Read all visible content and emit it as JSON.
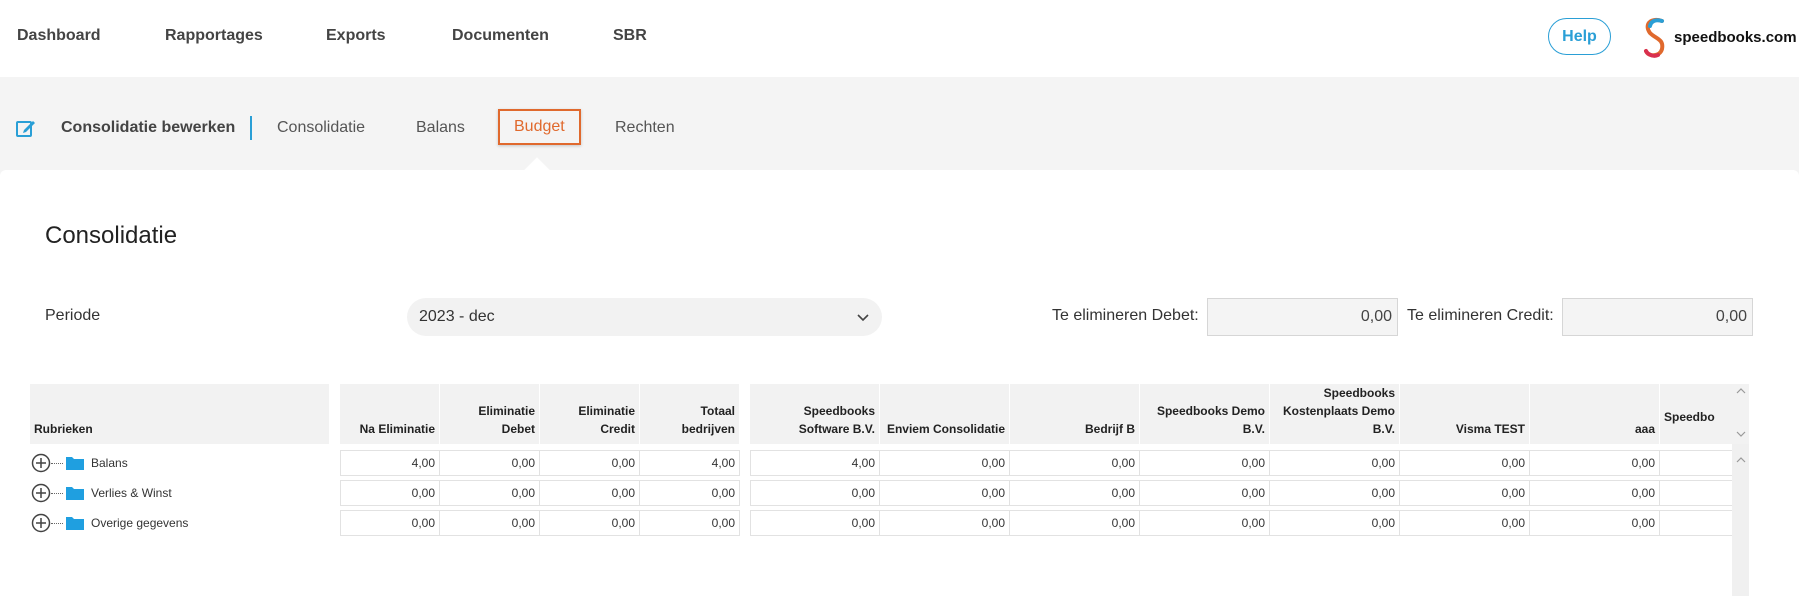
{
  "topnav": {
    "items": [
      "Dashboard",
      "Rapportages",
      "Exports",
      "Documenten",
      "SBR"
    ],
    "help_label": "Help",
    "logo_text": "speedbooks.com"
  },
  "subnav": {
    "title": "Consolidatie bewerken",
    "tabs": [
      "Consolidatie",
      "Balans",
      "Budget",
      "Rechten"
    ],
    "active_tab": "Budget"
  },
  "page": {
    "title": "Consolidatie",
    "periode_label": "Periode",
    "periode_value": "2023 - dec",
    "debet_label": "Te elimineren Debet:",
    "debet_value": "0,00",
    "credit_label": "Te elimineren Credit:",
    "credit_value": "0,00"
  },
  "grid": {
    "rubrieken_header": "Rubrieken",
    "summary_headers": [
      "Na Eliminatie",
      "Eliminatie Debet",
      "Eliminatie Credit",
      "Totaal bedrijven"
    ],
    "company_headers": [
      "Speedbooks Software B.V.",
      "Enviem Consolidatie",
      "Bedrijf B",
      "Speedbooks Demo B.V.",
      "Speedbooks Kostenplaats Demo B.V.",
      "Visma TEST",
      "aaa",
      "Speedbo"
    ],
    "rows": [
      {
        "label": "Balans",
        "summary": [
          "4,00",
          "0,00",
          "0,00",
          "4,00"
        ],
        "companies": [
          "4,00",
          "0,00",
          "0,00",
          "0,00",
          "0,00",
          "0,00",
          "0,00"
        ]
      },
      {
        "label": "Verlies & Winst",
        "summary": [
          "0,00",
          "0,00",
          "0,00",
          "0,00"
        ],
        "companies": [
          "0,00",
          "0,00",
          "0,00",
          "0,00",
          "0,00",
          "0,00",
          "0,00"
        ]
      },
      {
        "label": "Overige gegevens",
        "summary": [
          "0,00",
          "0,00",
          "0,00",
          "0,00"
        ],
        "companies": [
          "0,00",
          "0,00",
          "0,00",
          "0,00",
          "0,00",
          "0,00",
          "0,00"
        ]
      }
    ]
  },
  "colors": {
    "accent_blue": "#2a9fd6",
    "active_tab_orange": "#e0692d"
  }
}
